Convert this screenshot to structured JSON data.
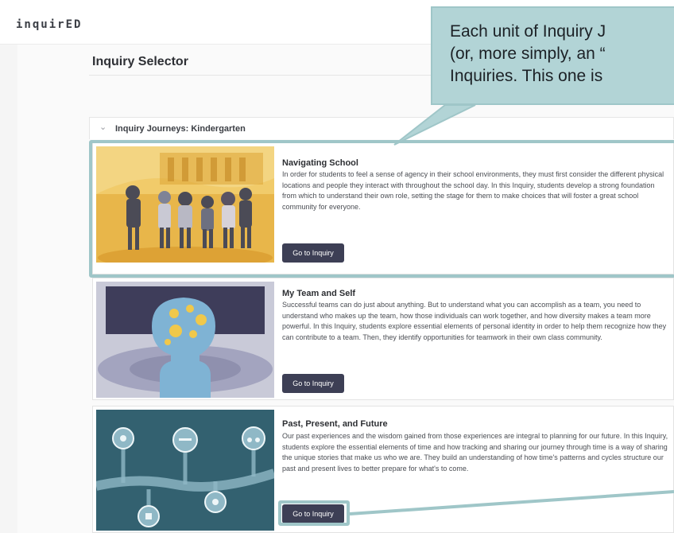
{
  "app": {
    "logo": "inquirED"
  },
  "page": {
    "title": "Inquiry Selector"
  },
  "accordion": {
    "chevron": "⌄",
    "title": "Inquiry Journeys: Kindergarten"
  },
  "cards": [
    {
      "title": "Navigating School",
      "description": "In order for students to feel a sense of agency in their school environments, they must first consider the different physical locations and people they interact with throughout the school day. In this Inquiry, students develop a strong foundation from which to understand their own role, setting the stage for them to make choices that will foster a great school community for everyone.",
      "button": "Go to Inquiry"
    },
    {
      "title": "My Team and Self",
      "description": "Successful teams can do just about anything. But to understand what you can accomplish as a team, you need to understand who makes up the team, how those individuals can work together, and how diversity makes a team more powerful. In this Inquiry, students explore essential elements of personal identity in order to help them recognize how they can contribute to a team. Then, they identify opportunities for teamwork in their own class community.",
      "button": "Go to Inquiry"
    },
    {
      "title": "Past, Present, and Future",
      "description": "Our past experiences and the wisdom gained from those experiences are integral to planning for our future. In this Inquiry, students explore the essential elements of time and how tracking and sharing our journey through time is a way of sharing the unique stories that make us who we are. They build an understanding of how time's patterns and cycles structure our past and present lives to better prepare for what's to come.",
      "button": "Go to Inquiry"
    }
  ],
  "callout": {
    "lines": [
      "Each unit of Inquiry J",
      "(or, more simply, an “",
      "Inquiries. This one is"
    ]
  },
  "colors": {
    "highlight": "#9fc6c8",
    "callout_fill": "#b2d4d6",
    "button": "#3d3f55"
  }
}
